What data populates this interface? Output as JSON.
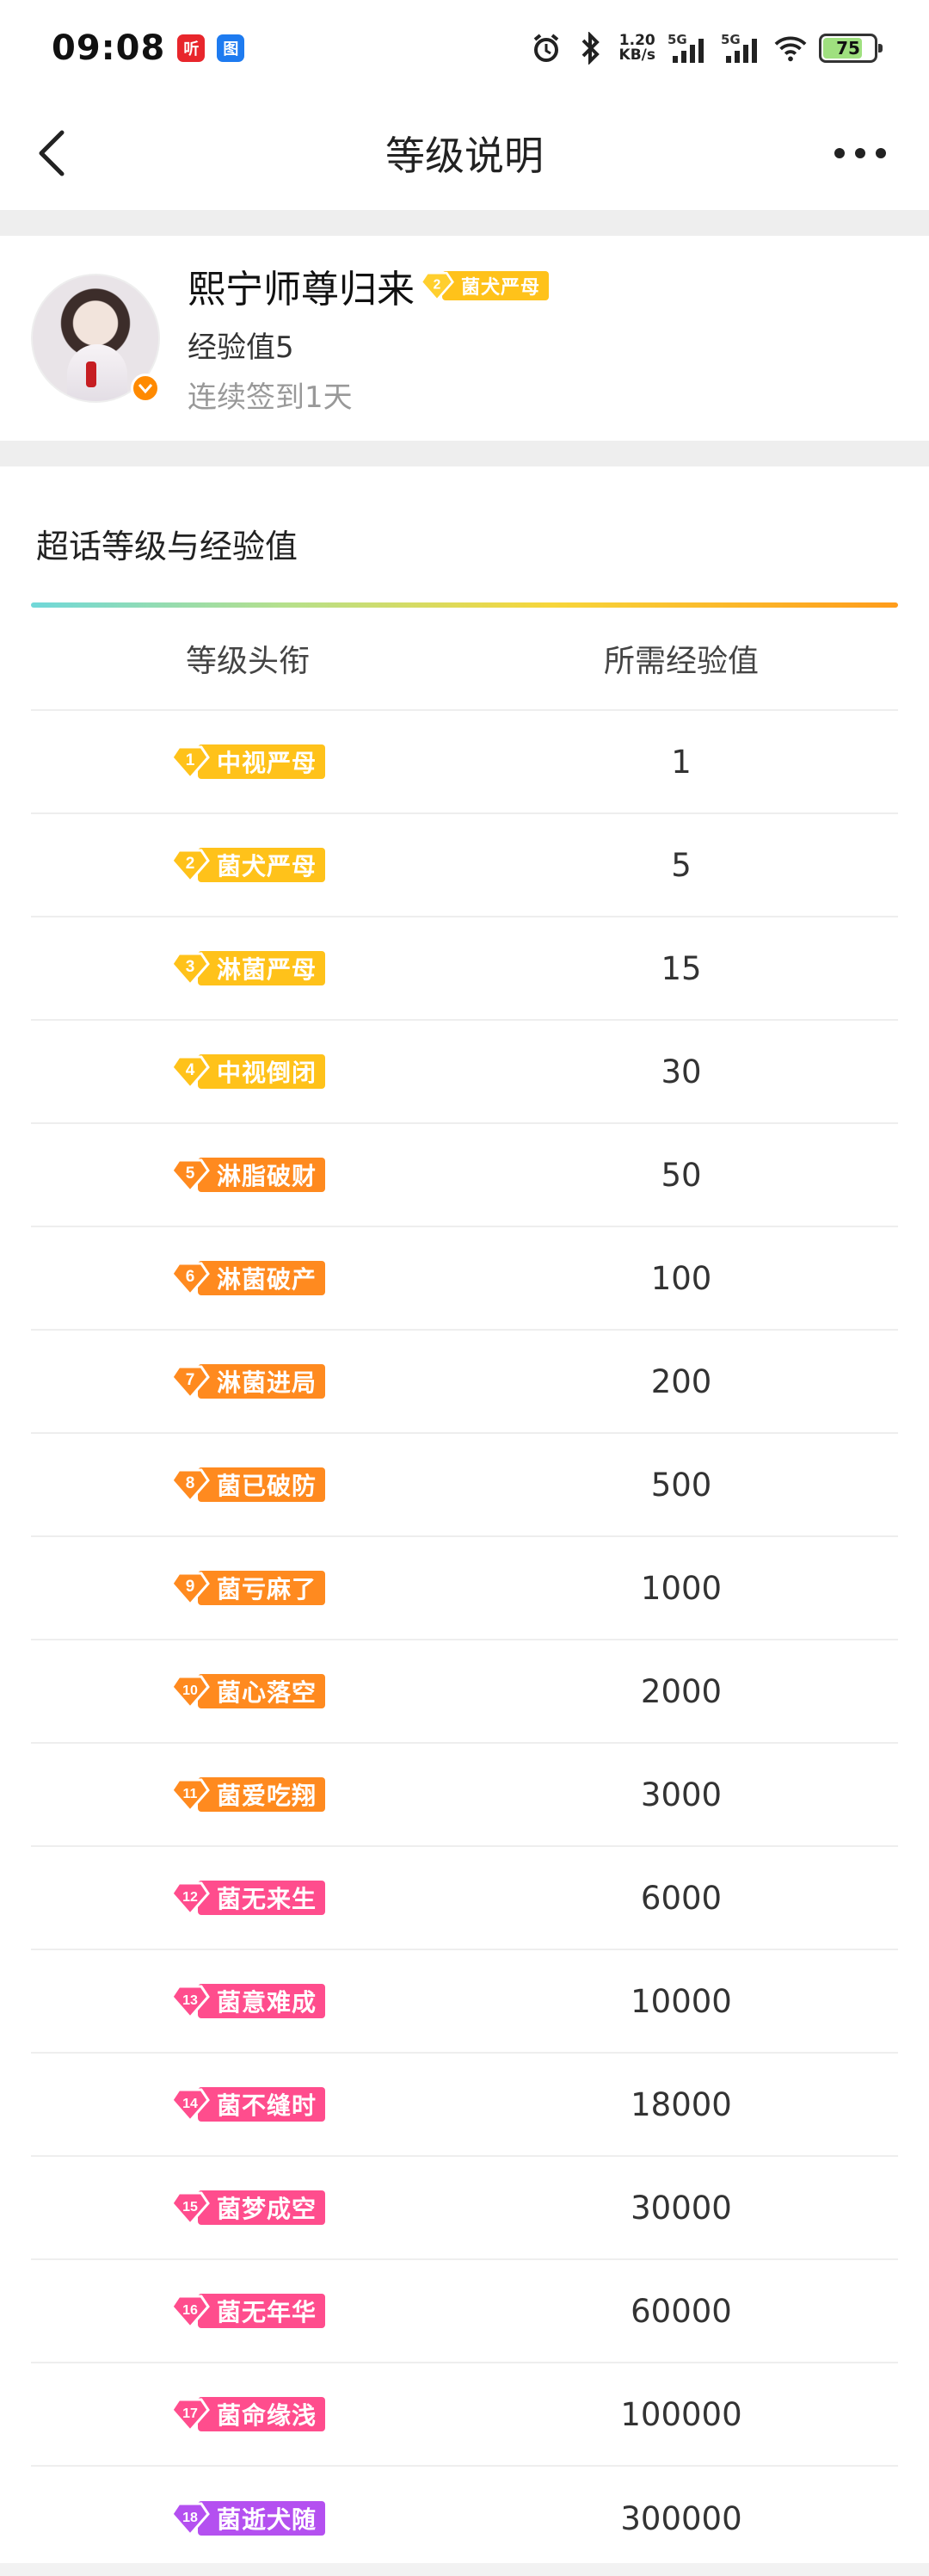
{
  "status_bar": {
    "time": "09:08",
    "app_icon_1": "听",
    "app_icon_2": "图",
    "net_speed_value": "1.20",
    "net_speed_unit": "KB/s",
    "sim1": "5G",
    "sim2": "5G",
    "battery": "75",
    "icons": [
      "alarm-icon",
      "bluetooth-icon",
      "signal-icon",
      "wifi-icon",
      "battery-icon"
    ]
  },
  "nav": {
    "title": "等级说明",
    "back_icon": "chevron-left-icon",
    "more_icon": "more-dots-icon"
  },
  "profile": {
    "name": "熙宁师尊归来",
    "level_num": "2",
    "level_title": "菌犬严母",
    "exp_text": "经验值5",
    "checkin_text": "连续签到1天"
  },
  "section": {
    "title": "超话等级与经验值"
  },
  "table": {
    "headers": [
      "等级头衔",
      "所需经验值"
    ],
    "rows": [
      {
        "num": "1",
        "title": "中视严母",
        "exp": "1"
      },
      {
        "num": "2",
        "title": "菌犬严母",
        "exp": "5"
      },
      {
        "num": "3",
        "title": "淋菌严母",
        "exp": "15"
      },
      {
        "num": "4",
        "title": "中视倒闭",
        "exp": "30"
      },
      {
        "num": "5",
        "title": "淋脂破财",
        "exp": "50"
      },
      {
        "num": "6",
        "title": "淋菌破产",
        "exp": "100"
      },
      {
        "num": "7",
        "title": "淋菌进局",
        "exp": "200"
      },
      {
        "num": "8",
        "title": "菌已破防",
        "exp": "500"
      },
      {
        "num": "9",
        "title": "菌亏麻了",
        "exp": "1000"
      },
      {
        "num": "10",
        "title": "菌心落空",
        "exp": "2000"
      },
      {
        "num": "11",
        "title": "菌爱吃翔",
        "exp": "3000"
      },
      {
        "num": "12",
        "title": "菌无来生",
        "exp": "6000"
      },
      {
        "num": "13",
        "title": "菌意难成",
        "exp": "10000"
      },
      {
        "num": "14",
        "title": "菌不缝时",
        "exp": "18000"
      },
      {
        "num": "15",
        "title": "菌梦成空",
        "exp": "30000"
      },
      {
        "num": "16",
        "title": "菌无年华",
        "exp": "60000"
      },
      {
        "num": "17",
        "title": "菌命缘浅",
        "exp": "100000"
      },
      {
        "num": "18",
        "title": "菌逝犬随",
        "exp": "300000"
      }
    ]
  },
  "colors": {
    "tier_yellow": "#ffc21a",
    "tier_orange": "#ff8a1f",
    "tier_pink": "#ff4d8d",
    "tier_purple": "#b450f0",
    "accent_orange": "#ff8a00",
    "divider": "#eeeeee"
  }
}
